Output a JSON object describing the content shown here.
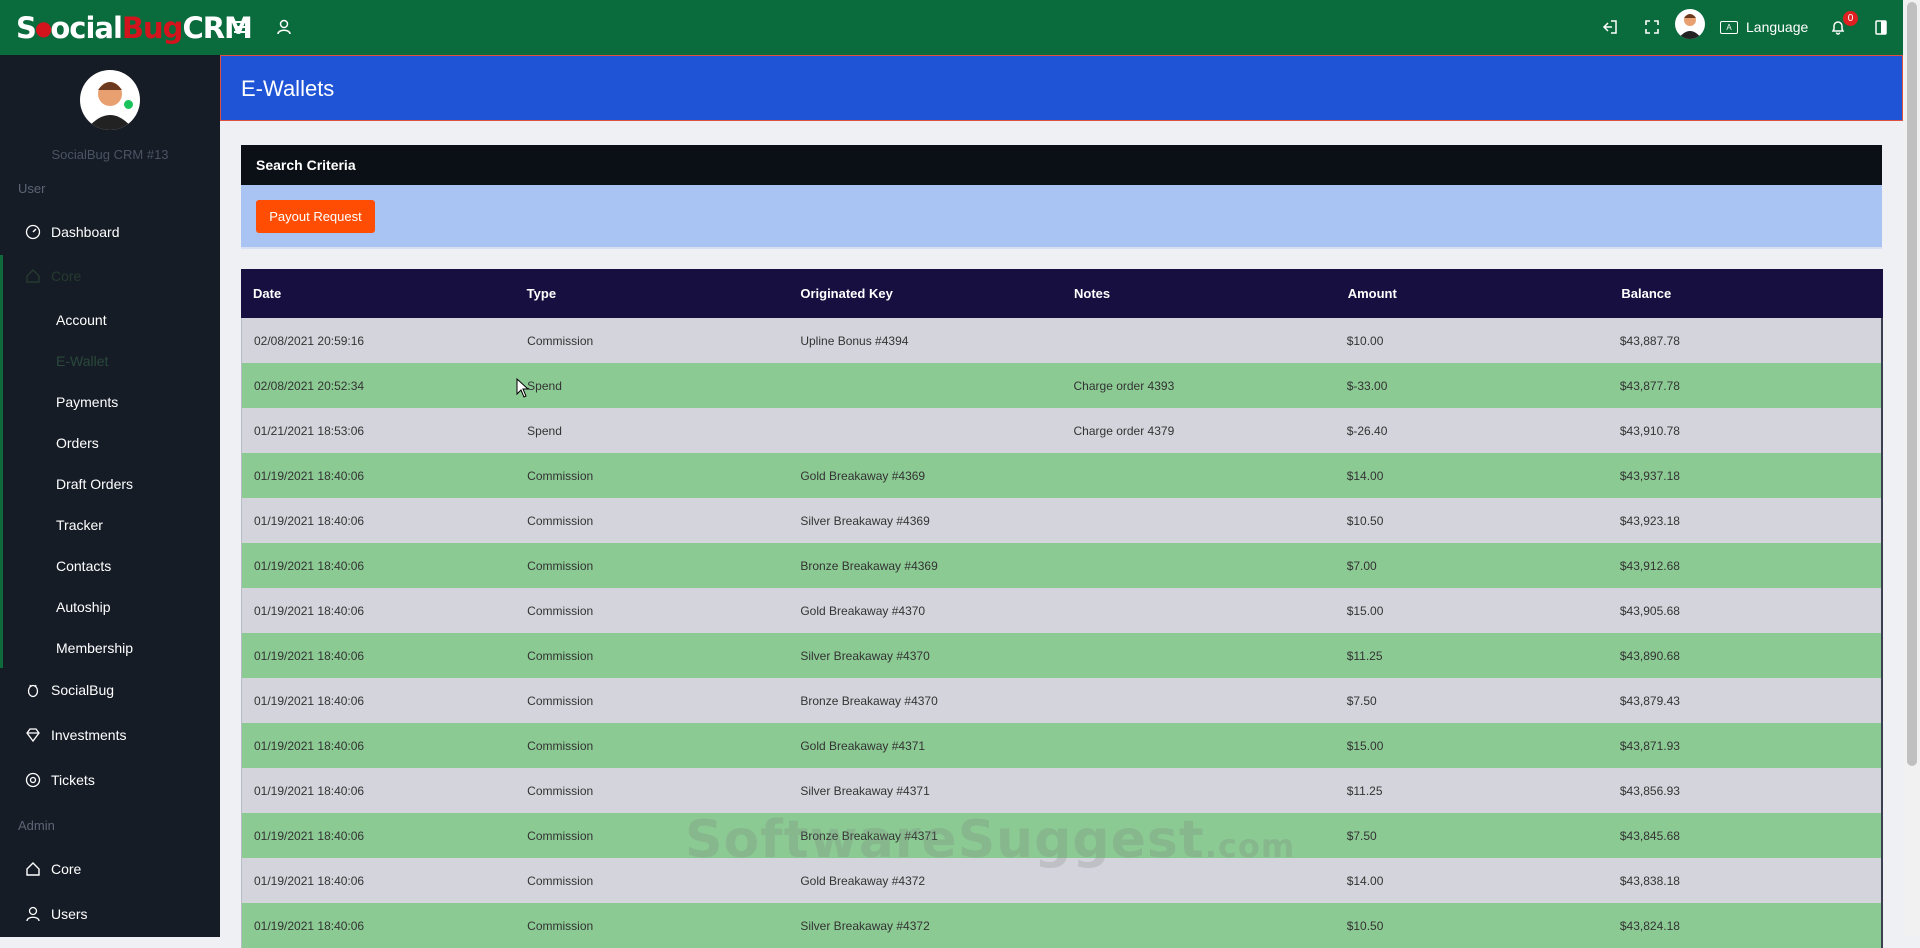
{
  "brand": {
    "part1": "S",
    "part2": "ocial",
    "part3": "Bug",
    "part4": "CRM"
  },
  "topbar": {
    "language_label": "Language",
    "notification_count": "0"
  },
  "sidebar": {
    "user_name": "SocialBug CRM #13",
    "section_user": "User",
    "dashboard": "Dashboard",
    "core": "Core",
    "core_items": [
      "Account",
      "E-Wallet",
      "Payments",
      "Orders",
      "Draft Orders",
      "Tracker",
      "Contacts",
      "Autoship",
      "Membership"
    ],
    "socialbug": "SocialBug",
    "investments": "Investments",
    "tickets": "Tickets",
    "section_admin": "Admin",
    "admin_core": "Core",
    "users": "Users"
  },
  "page": {
    "title": "E-Wallets"
  },
  "search": {
    "title": "Search Criteria",
    "payout_button": "Payout Request"
  },
  "table": {
    "columns": [
      "Date",
      "Type",
      "Originated Key",
      "Notes",
      "Amount",
      "Balance"
    ],
    "rows": [
      [
        "02/08/2021 20:59:16",
        "Commission",
        "Upline Bonus #4394",
        "",
        "$10.00",
        "$43,887.78"
      ],
      [
        "02/08/2021 20:52:34",
        "Spend",
        "",
        "Charge order 4393",
        "$-33.00",
        "$43,877.78"
      ],
      [
        "01/21/2021 18:53:06",
        "Spend",
        "",
        "Charge order 4379",
        "$-26.40",
        "$43,910.78"
      ],
      [
        "01/19/2021 18:40:06",
        "Commission",
        "Gold Breakaway #4369",
        "",
        "$14.00",
        "$43,937.18"
      ],
      [
        "01/19/2021 18:40:06",
        "Commission",
        "Silver Breakaway #4369",
        "",
        "$10.50",
        "$43,923.18"
      ],
      [
        "01/19/2021 18:40:06",
        "Commission",
        "Bronze Breakaway #4369",
        "",
        "$7.00",
        "$43,912.68"
      ],
      [
        "01/19/2021 18:40:06",
        "Commission",
        "Gold Breakaway #4370",
        "",
        "$15.00",
        "$43,905.68"
      ],
      [
        "01/19/2021 18:40:06",
        "Commission",
        "Silver Breakaway #4370",
        "",
        "$11.25",
        "$43,890.68"
      ],
      [
        "01/19/2021 18:40:06",
        "Commission",
        "Bronze Breakaway #4370",
        "",
        "$7.50",
        "$43,879.43"
      ],
      [
        "01/19/2021 18:40:06",
        "Commission",
        "Gold Breakaway #4371",
        "",
        "$15.00",
        "$43,871.93"
      ],
      [
        "01/19/2021 18:40:06",
        "Commission",
        "Silver Breakaway #4371",
        "",
        "$11.25",
        "$43,856.93"
      ],
      [
        "01/19/2021 18:40:06",
        "Commission",
        "Bronze Breakaway #4371",
        "",
        "$7.50",
        "$43,845.68"
      ],
      [
        "01/19/2021 18:40:06",
        "Commission",
        "Gold Breakaway #4372",
        "",
        "$14.00",
        "$43,838.18"
      ],
      [
        "01/19/2021 18:40:06",
        "Commission",
        "Silver Breakaway #4372",
        "",
        "$10.50",
        "$43,824.18"
      ]
    ]
  },
  "watermark": {
    "text": "SoftwareSuggest",
    "suffix": ".com"
  },
  "colors": {
    "topbar": "#0a6b3c",
    "sidebar": "#161c26",
    "header": "#1f54d6",
    "table_head": "#160f40",
    "row_green": "#8cca94",
    "row_gray": "#d4d5dc",
    "button": "#ff4d04"
  }
}
